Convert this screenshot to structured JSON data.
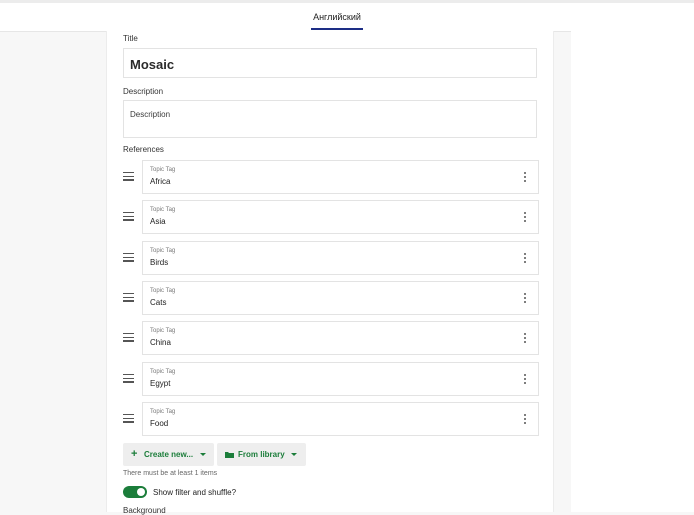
{
  "header": {
    "tab_label": "Английский"
  },
  "form": {
    "title_label": "Title",
    "title_value": "Mosaic",
    "description_label": "Description",
    "description_value": "Description",
    "references_label": "References",
    "references": [
      {
        "type": "Topic Tag",
        "value": "Africa"
      },
      {
        "type": "Topic Tag",
        "value": "Asia"
      },
      {
        "type": "Topic Tag",
        "value": "Birds"
      },
      {
        "type": "Topic Tag",
        "value": "Cats"
      },
      {
        "type": "Topic Tag",
        "value": "China"
      },
      {
        "type": "Topic Tag",
        "value": "Egypt"
      },
      {
        "type": "Topic Tag",
        "value": "Food"
      }
    ],
    "create_new_label": "Create new...",
    "from_library_label": "From library",
    "hint_text": "There must be at least 1 items",
    "toggle_label": "Show filter and shuffle?",
    "toggle_on": true,
    "background_label": "Background"
  },
  "colors": {
    "accent_green": "#1b7d3a",
    "tab_underline": "#1d2e86"
  },
  "icons": {
    "drag": "drag-handle-icon",
    "menu": "kebab-menu-icon",
    "plus": "plus-icon",
    "folder": "folder-icon",
    "caret": "caret-down-icon"
  }
}
